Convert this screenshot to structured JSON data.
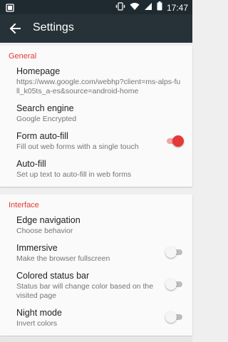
{
  "status_bar": {
    "time": "17:47"
  },
  "app_bar": {
    "title": "Settings"
  },
  "sections": [
    {
      "header": "General",
      "items": [
        {
          "title": "Homepage",
          "summary": "https://www.google.com/webhp?client=ms-alps-full_k05ts_a-es&source=android-home"
        },
        {
          "title": "Search engine",
          "summary": "Google Encrypted"
        },
        {
          "title": "Form auto-fill",
          "summary": "Fill out web forms with a single touch",
          "toggle": true
        },
        {
          "title": "Auto-fill",
          "summary": "Set up text to auto-fill in web forms"
        }
      ]
    },
    {
      "header": "Interface",
      "items": [
        {
          "title": "Edge navigation",
          "summary": "Choose behavior"
        },
        {
          "title": "Immersive",
          "summary": "Make the browser fullscreen",
          "toggle": false
        },
        {
          "title": "Colored status bar",
          "summary": "Status bar will change color based on the visited page",
          "toggle": false
        },
        {
          "title": "Night mode",
          "summary": "Invert colors",
          "toggle": false
        }
      ]
    }
  ],
  "colors": {
    "accent": "#e53935",
    "app_bar": "#263238",
    "status_bar": "#1f2a30"
  }
}
